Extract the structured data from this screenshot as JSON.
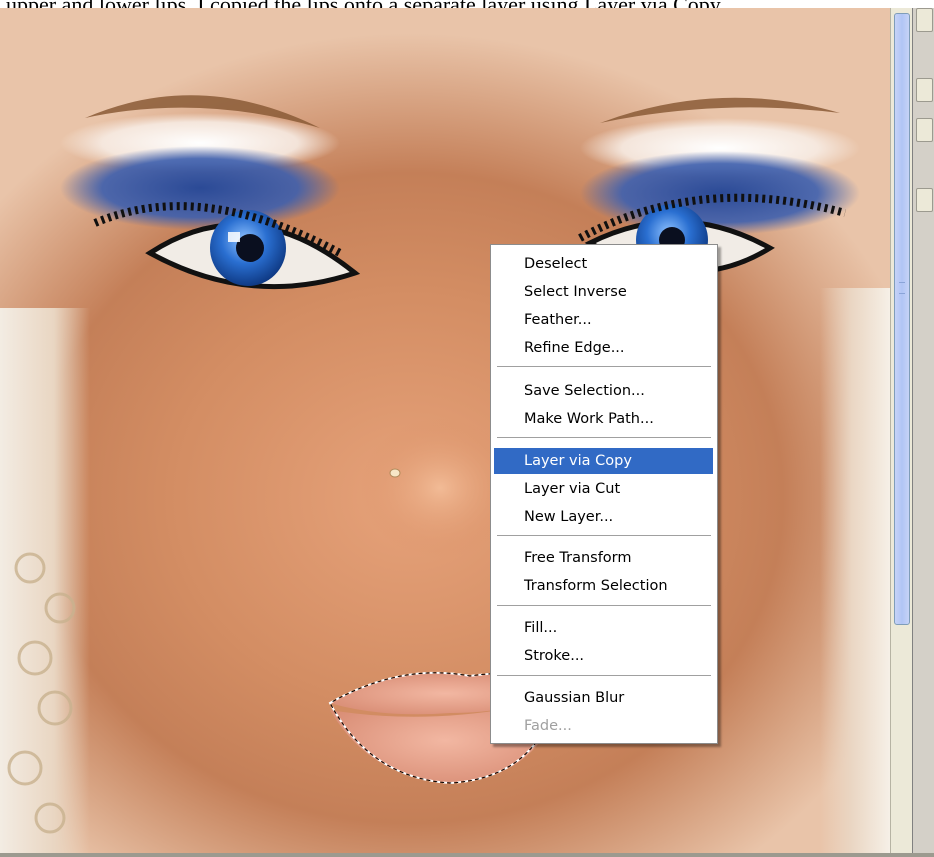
{
  "caption": "upper and lower lips. I copied the lips onto a separate layer using Layer via Copy.",
  "canvas": {
    "photo": "close-up of a woman's face with blue eye makeup and selected lips"
  },
  "context_menu": {
    "groups": [
      {
        "items": [
          {
            "label": "Deselect"
          },
          {
            "label": "Select Inverse"
          },
          {
            "label": "Feather..."
          },
          {
            "label": "Refine Edge..."
          }
        ]
      },
      {
        "items": [
          {
            "label": "Save Selection..."
          },
          {
            "label": "Make Work Path..."
          }
        ]
      },
      {
        "items": [
          {
            "label": "Layer via Copy",
            "highlighted": true
          },
          {
            "label": "Layer via Cut"
          },
          {
            "label": "New Layer..."
          }
        ]
      },
      {
        "items": [
          {
            "label": "Free Transform"
          },
          {
            "label": "Transform Selection"
          }
        ]
      },
      {
        "items": [
          {
            "label": "Fill..."
          },
          {
            "label": "Stroke..."
          }
        ]
      },
      {
        "items": [
          {
            "label": "Gaussian Blur"
          },
          {
            "label": "Fade...",
            "disabled": true
          }
        ]
      }
    ]
  },
  "colors": {
    "menu_highlight": "#316ac5",
    "eyeshadow": "#2f4f9e",
    "iris": "#2a6fd1",
    "skin": "#d38d63"
  }
}
